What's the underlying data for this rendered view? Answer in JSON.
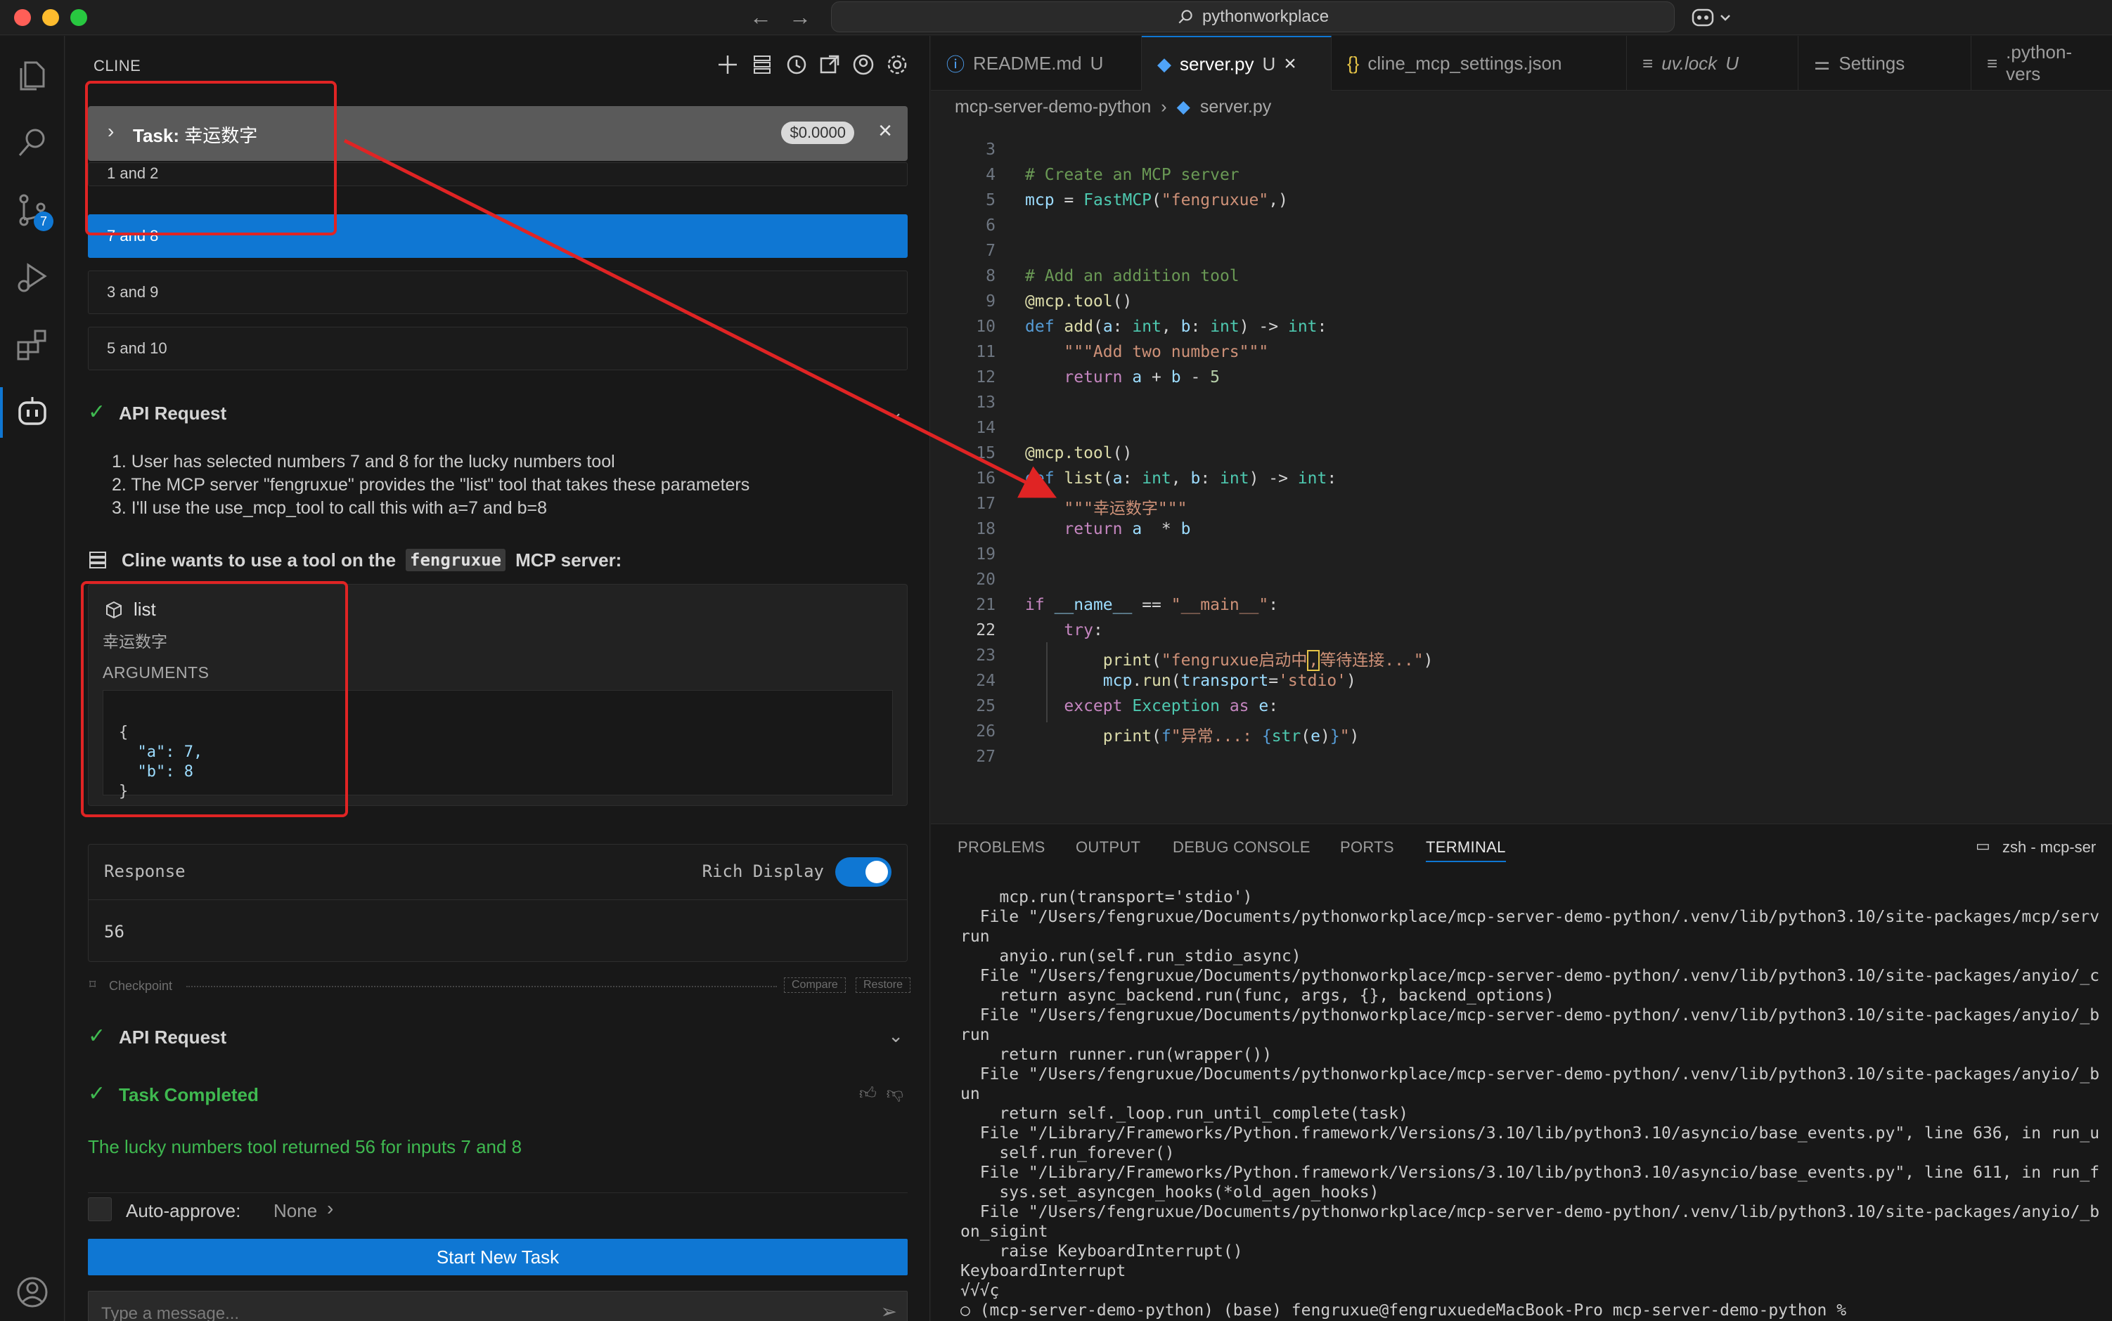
{
  "titlebar": {
    "search_text": "pythonworkplace"
  },
  "activity": {
    "source_control_badge": "7"
  },
  "sidebar": {
    "title": "CLINE",
    "task": {
      "label_prefix": "Task:",
      "label_text": "幸运数字",
      "cost": "$0.0000"
    },
    "options": [
      "1 and 2",
      "7 and 8",
      "3 and 9",
      "5 and 10"
    ],
    "selected_option_index": 1,
    "api_request_1": "API Request",
    "steps": [
      "1. User has selected numbers 7 and 8 for the lucky numbers tool",
      "2. The MCP server \"fengruxue\" provides the \"list\" tool that takes these parameters",
      "3. I'll use the use_mcp_tool to call this with a=7 and b=8"
    ],
    "tool_use": {
      "prefix": "Cline wants to use a tool on the",
      "server": "fengruxue",
      "suffix": "MCP server:"
    },
    "tool_card": {
      "name": "list",
      "description": "幸运数字",
      "args_label": "ARGUMENTS",
      "args_lines": [
        "{",
        "  \"a\": 7,",
        "  \"b\": 8",
        "}"
      ]
    },
    "response": {
      "label": "Response",
      "rich_display_label": "Rich Display",
      "rich_display_on": true,
      "value": "56"
    },
    "checkpoint": {
      "label": "Checkpoint",
      "compare": "Compare",
      "restore": "Restore"
    },
    "api_request_2": "API Request",
    "task_completed": "Task Completed",
    "result_text": "The lucky numbers tool returned 56 for inputs 7 and 8",
    "auto_approve_label": "Auto-approve:",
    "auto_approve_value": "None",
    "start_new_task": "Start New Task",
    "message_placeholder": "Type a message..."
  },
  "editor": {
    "tabs": [
      {
        "label": "README.md",
        "status": "U",
        "icon": "info-icon"
      },
      {
        "label": "server.py",
        "status": "U",
        "icon": "python-icon",
        "active": true
      },
      {
        "label": "cline_mcp_settings.json",
        "status": "",
        "icon": "json-icon"
      },
      {
        "label": "uv.lock",
        "status": "U",
        "icon": "lines-icon"
      },
      {
        "label": "Settings",
        "status": "",
        "icon": "settings-icon"
      },
      {
        "label": ".python-vers",
        "status": "",
        "icon": "lines-icon"
      }
    ],
    "breadcrumb": [
      "mcp-server-demo-python",
      "server.py"
    ],
    "current_line": 22,
    "line_numbers": [
      "3",
      "4",
      "5",
      "6",
      "7",
      "8",
      "9",
      "10",
      "11",
      "12",
      "13",
      "14",
      "15",
      "16",
      "17",
      "18",
      "19",
      "20",
      "21",
      "22",
      "23",
      "24",
      "25",
      "26",
      "27"
    ]
  },
  "panel": {
    "tabs": [
      "PROBLEMS",
      "OUTPUT",
      "DEBUG CONSOLE",
      "PORTS",
      "TERMINAL"
    ],
    "active_tab": "TERMINAL",
    "terminal_name": "zsh - mcp-ser",
    "terminal_lines": [
      "    mcp.run(transport='stdio')",
      "  File \"/Users/fengruxue/Documents/pythonworkplace/mcp-server-demo-python/.venv/lib/python3.10/site-packages/mcp/serv",
      "run",
      "    anyio.run(self.run_stdio_async)",
      "  File \"/Users/fengruxue/Documents/pythonworkplace/mcp-server-demo-python/.venv/lib/python3.10/site-packages/anyio/_c",
      "    return async_backend.run(func, args, {}, backend_options)",
      "  File \"/Users/fengruxue/Documents/pythonworkplace/mcp-server-demo-python/.venv/lib/python3.10/site-packages/anyio/_b",
      "run",
      "    return runner.run(wrapper())",
      "  File \"/Users/fengruxue/Documents/pythonworkplace/mcp-server-demo-python/.venv/lib/python3.10/site-packages/anyio/_b",
      "un",
      "    return self._loop.run_until_complete(task)",
      "  File \"/Library/Frameworks/Python.framework/Versions/3.10/lib/python3.10/asyncio/base_events.py\", line 636, in run_u",
      "    self.run_forever()",
      "  File \"/Library/Frameworks/Python.framework/Versions/3.10/lib/python3.10/asyncio/base_events.py\", line 611, in run_f",
      "    sys.set_asyncgen_hooks(*old_agen_hooks)",
      "  File \"/Users/fengruxue/Documents/pythonworkplace/mcp-server-demo-python/.venv/lib/python3.10/site-packages/anyio/_b",
      "on_sigint",
      "    raise KeyboardInterrupt()",
      "KeyboardInterrupt",
      "√√√ç",
      "○ (mcp-server-demo-python) (base) fengruxue@fengruxuedeMacBook-Pro mcp-server-demo-python %"
    ]
  }
}
